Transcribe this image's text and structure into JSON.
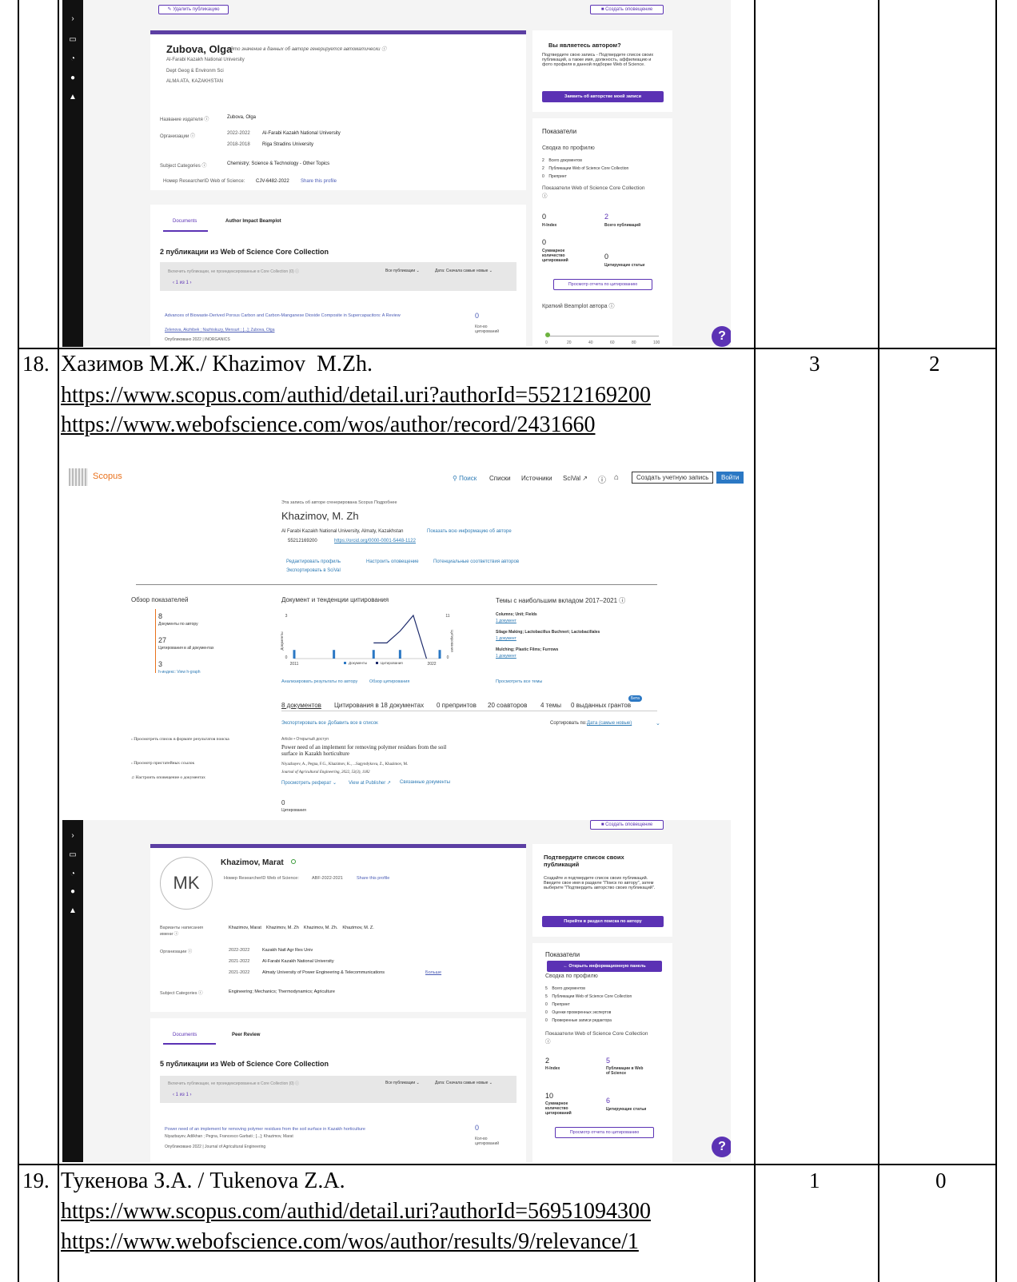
{
  "rows": [
    {
      "num": "18.",
      "name": "Хазимов М.Ж./ Khazimov  M.Zh.",
      "scopus_url": "https://www.scopus.com/authid/detail.uri?authorId=55212169200",
      "wos_url": "https://www.webofscience.com/wos/author/record/2431660",
      "col3": "3",
      "col4": "2"
    },
    {
      "num": "19.",
      "name": "Тукенова З.А. / Tukenova Z.A.",
      "scopus_url": "https://www.scopus.com/authid/detail.uri?authorId=56951094300",
      "wos_url": "https://www.webofscience.com/wos/author/results/9/relevance/1",
      "col3": "1",
      "col4": "0"
    }
  ],
  "wos1": {
    "top_left_btn": "✎ Удалить публикацию",
    "top_right_btn": "■ Создать оповещение",
    "author_name": "Zubova, Olga",
    "auto_note": "Это значение в данных об авторе генерируется автоматически ⓘ",
    "affil1": "Al-Farabi Kazakh National University",
    "affil2": "Dept Geog & Environm Sci",
    "affil3": "ALMA ATA, KAZAKHSTAN",
    "pub_name_label": "Название издателя  ⓘ",
    "pub_name_val": "Zubova, Olga",
    "org_label": "Организации  ⓘ",
    "org1_years": "2022-2022",
    "org1": "Al-Farabi Kazakh National University",
    "org2_years": "2018-2018",
    "org2": "Riga Stradins University",
    "subj_label": "Subject Categories  ⓘ",
    "subj_val": "Chemistry; Science & Technology - Other Topics",
    "rid_label": "Номер ResearcherID Web of Science:",
    "rid_val": "CJV-6482-2022",
    "share": "Share this profile",
    "tab1": "Documents",
    "tab2": "Author Impact Beamplot",
    "pubs_title": "2 публикации из Web of Science Core Collection",
    "include_label": "Включить публикации, не проиндексированные в Core Collection (0)  ⓘ",
    "all_pubs": "Все публикации ⌄",
    "date_sort": "Дата: Сначала самые новые ⌄",
    "pager": "‹  1  из 1  ›",
    "art_title": "Advances of Biowaste-Derived Porous Carbon and Carbon-Manganese Dioxide Composite in Supercapacitors: A Review",
    "art_authors": "Zelenova, Akzhibek ; Nazhiskuzy, Mensurt ; [...]; Zubova, Olga",
    "art_pub": "Опубликовано 2022 | INORGANICS",
    "art_cites": "0",
    "art_cites_label": "Кол-во цитирований",
    "claim_title": "Вы являетесь автором?",
    "claim_text": "Подтвердите свою запись - Подтвердите список своих публикаций, а также имя, должность, аффилиацию и фото профиля в данной подборке Web of Science.",
    "claim_btn": "Заявить об авторстве моей записи",
    "metrics_title": "Показатели",
    "summary": "Сводка по профилю",
    "m1": "2    Всего документов",
    "m2": "2    Публикации Web of Science Core Collection",
    "m3": "0    Препринт",
    "wos_metrics": "Показатели Web of Science Core Collection  ⓘ",
    "hindex_val": "0",
    "hindex_label": "H-Index",
    "total_val": "2",
    "total_label": "Всего публикаций",
    "sum_val": "0",
    "sum_label": "Суммарное количество цитирований",
    "citing_val": "0",
    "citing_label": "Цитирующие статьи",
    "report_btn": "Просмотр отчета по цитированию",
    "beamplot": "Краткий Beamplot автора ⓘ",
    "beam_ticks": [
      "0",
      "20",
      "40",
      "60",
      "80",
      "100"
    ],
    "help_badge": "?"
  },
  "scopus": {
    "logo": "Scopus",
    "nav": [
      "Поиск",
      "Списки",
      "Источники",
      "SciVal ↗"
    ],
    "create_acc": "Создать учетную запись",
    "login": "Войти",
    "auto_note": "Эта запись об авторе сгенерирована Scopus Подробнее",
    "name": "Khazimov, M. Zh",
    "affil": "Al Farabi Kazakh National University, Almaty, Kazakhstan",
    "show_all": "Показать всю информацию об авторе",
    "ids": "55212169200",
    "orcid": "https://orcid.org/0000-0001-5448-1122",
    "actions": [
      "Редактировать профиль",
      "Настроить оповещение",
      "Потенциальные соответствия авторов",
      "Экспортировать в SciVal"
    ],
    "overview_title": "Обзор показателей",
    "docs_val": "8",
    "docs_label": "Документы по автору",
    "cites_val": "27",
    "cites_label": "Цитирования в all документах",
    "h_val": "3",
    "h_label": "h-индекс: View h-graph",
    "trend_title": "Документ и тенденции цитирования",
    "topics_title": "Темы с наибольшим вкладом 2017–2021 ⓘ",
    "topic1": "Columns; Unit; Fields",
    "topic1_docs": "1 документ",
    "topic2": "Silage Making; Lactobacillus Buchneri; Lactobacillales",
    "topic2_docs": "1 документ",
    "topic3": "Mulching; Plastic Films; Furrows",
    "topic3_docs": "1 документ",
    "view_topics": "Просмотреть все темы",
    "analyze": "Анализировать результаты по автору",
    "cite_overview": "Обзор цитирования",
    "tabs": [
      "8 документов",
      "Цитирования в 18 документах",
      "0 препринтов",
      "20 соавторов",
      "4 темы",
      "0 выданных грантов"
    ],
    "beta": "Бета",
    "export_all": "Экспортировать все",
    "add_all": "Добавить все в список",
    "sort_label": "Сортировать по:",
    "sort_val": "Дата (самые новые)",
    "left1": "Просмотреть список в формате результатов поиска",
    "left2": "Просмотр пристатейных ссылок",
    "left3": "Настроить оповещение о документах",
    "doc_type": "Article • Открытый доступ",
    "doc_title": "Power need of an implement for removing polymer residues from the soil surface in Kazakh horticulture",
    "doc_authors": "Niyazbayev, A., Pegna, F.G., Khazimov, K., ...Sagyndykova, Z., Khazimov, M.",
    "doc_journal": "Journal of Agricultural Engineering, 2022, 53(3), 1182",
    "doc_links": [
      "Просмотреть реферат ⌄",
      "View at Publisher ↗",
      "Связанные документы"
    ],
    "doc_cites": "0",
    "doc_cites_label": "Цитирования"
  },
  "chart_data": {
    "type": "bar",
    "x": [
      "2011",
      "",
      "",
      "",
      "",
      "",
      "",
      "",
      "",
      "",
      "",
      "2022"
    ],
    "xticks": [
      "2011",
      "2022"
    ],
    "series": [
      {
        "name": "Документы",
        "type": "bar",
        "values": [
          1,
          0,
          0,
          1,
          0,
          0,
          1,
          0,
          1,
          0,
          0,
          1
        ]
      },
      {
        "name": "Цитирования",
        "type": "line",
        "values": [
          0,
          0,
          0,
          0,
          0,
          0,
          4,
          4,
          7,
          11,
          0,
          0
        ]
      }
    ],
    "y_left_ticks": [
      "0",
      "3"
    ],
    "y_right_ticks": [
      "0",
      "11"
    ],
    "ylabel_left": "Документы",
    "ylabel_right": "Цитирования"
  },
  "wos2": {
    "top_right_btn": "■ Создать оповещение",
    "avatar": "MK",
    "name": "Khazimov, Marat",
    "rid_label": "Номер ResearcherID Web of Science:",
    "rid_val": "ABF-2022-2021",
    "share": "Share this profile",
    "variants_label": "Варианты написания имени  ⓘ",
    "variants": "Khazimov, Marat    Khazimov, M. Zh    Khazimov, M. Zh.    Khazimov, M. Z.",
    "org_label": "Организации  ⓘ",
    "org1_years": "2022-2022",
    "org1": "Kazakh Natl Agr Res Univ",
    "org2_years": "2021-2022",
    "org2": "Al-Farabi Kazakh National University",
    "org3_years": "2021-2022",
    "org3": "Almaty University of Power Engineering & Telecommunications",
    "more": "Больше",
    "subj_label": "Subject Categories  ⓘ",
    "subj_val": "Engineering; Mechanics; Thermodynamics; Agriculture",
    "tab1": "Documents",
    "tab2": "Peer Review",
    "pubs_title": "5 публикации из Web of Science Core Collection",
    "include_label": "Включить публикации, не проиндексированные в Core Collection (0)  ⓘ",
    "all_pubs": "Все публикации ⌄",
    "date_sort": "Дата: Сначала самые новые ⌄",
    "pager": "‹  1  из 1  ›",
    "art_title": "Power need of an implement for removing polymer residues from the soil surface in Kazakh horticulture",
    "art_authors": "Niyazbayev, Adilkhan ; Pegna, Francesco Garbati ; [...]; Khazimov, Marat",
    "art_pub": "Опубликовано 2022 | Journal of Agricultural Engineering",
    "art_cites": "0",
    "art_cites_label": "Кол-во цитирований",
    "confirm_title": "Подтвердите список своих публикаций",
    "confirm_text": "Создайте и подтвердите список своих публикаций. Введите свое имя в разделе \"Поиск по автору\", затем выберите \"Подтвердить авторство своих публикаций\".",
    "confirm_btn": "Перейти в раздел поиска по автору",
    "metrics_title": "Показатели",
    "open_panel": "← Открыть информационную панель",
    "summary": "Сводка по профилю",
    "m1": "5    Всего документов",
    "m2": "5    Публикации Web of Science Core Collection",
    "m3": "0    Препринт",
    "m4": "0    Оценки проверенных экспертов",
    "m5": "0    Проверенные записи редактора",
    "wos_metrics": "Показатели Web of Science Core Collection  ⓘ",
    "hindex_val": "2",
    "hindex_label": "H-Index",
    "total_val": "5",
    "total_label": "Публикации в Web of Science",
    "sum_val": "10",
    "sum_label": "Суммарное количество цитирований",
    "citing_val": "6",
    "citing_label": "Цитирующие статьи",
    "report_btn": "Просмотр отчета по цитированию",
    "help_badge": "?"
  }
}
